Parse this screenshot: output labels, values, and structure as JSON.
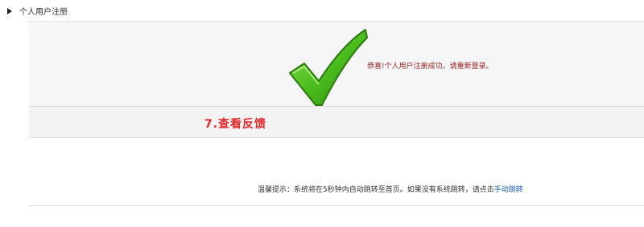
{
  "header": {
    "title": "个人用户注册"
  },
  "success": {
    "icon": "checkmark-icon",
    "message": "恭喜!个人用户注册成功，请重新登录。"
  },
  "step": {
    "label": "7.查看反馈"
  },
  "notice": {
    "text": "温馨提示：系统将在5秒钟内自动跳转至首页。如果没有系统跳转，请点击",
    "link": "手动跳转"
  },
  "colors": {
    "check_green": "#4cbe1e",
    "step_red": "#e02828",
    "message_red": "#9b1c1c",
    "link_blue": "#1a5fb4"
  }
}
